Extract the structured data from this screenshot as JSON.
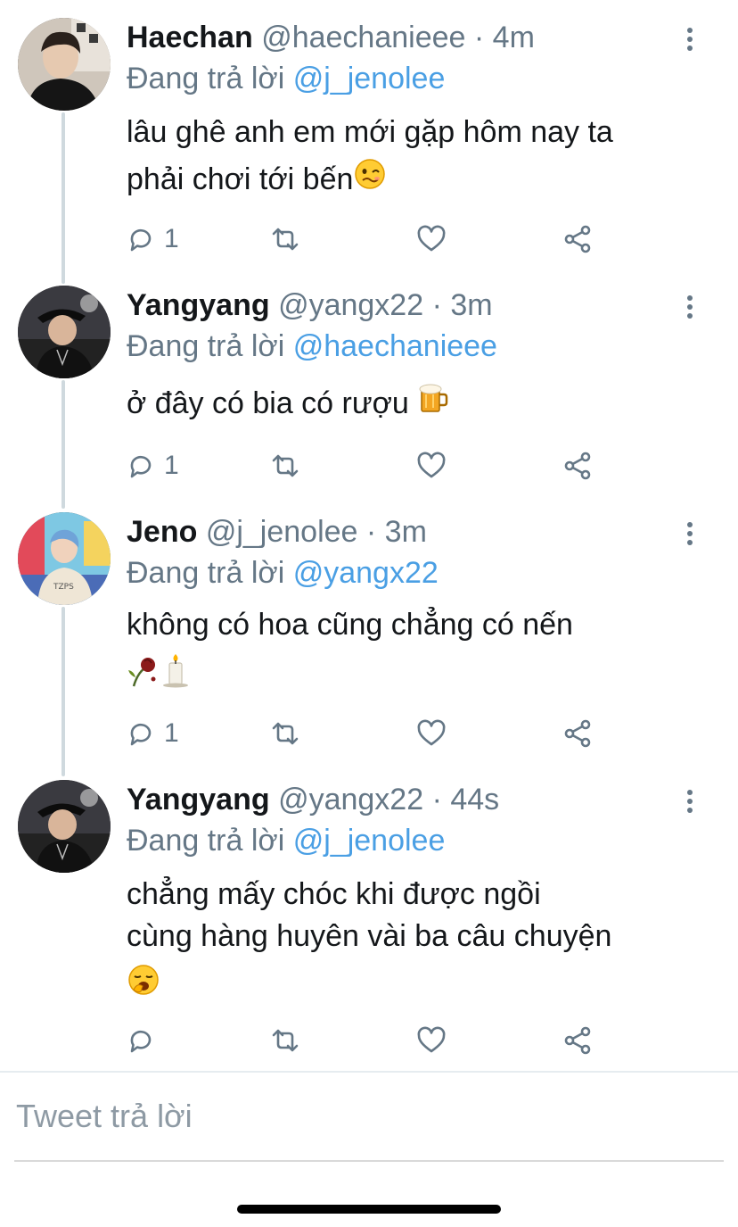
{
  "reply_prefix": "Đang trả lời",
  "tweets": [
    {
      "name": "Haechan",
      "handle": "@haechanieee",
      "time": "4m",
      "reply_to": "@j_jenolee",
      "lines": [
        "lâu ghê anh em mới gặp hôm nay ta",
        "phải chơi tới bến"
      ],
      "emoji": "woozy-face",
      "reply_count": "1"
    },
    {
      "name": "Yangyang",
      "handle": "@yangx22",
      "time": "3m",
      "reply_to": "@haechanieee",
      "lines": [
        "ở đây có bia có rượu"
      ],
      "emoji": "beer-mug",
      "reply_count": "1"
    },
    {
      "name": "Jeno",
      "handle": "@j_jenolee",
      "time": "3m",
      "reply_to": "@yangx22",
      "lines": [
        "không có hoa cũng chẳng có nến"
      ],
      "emoji": "wilted-rose-and-candle",
      "reply_count": "1"
    },
    {
      "name": "Yangyang",
      "handle": "@yangx22",
      "time": "44s",
      "reply_to": "@j_jenolee",
      "lines": [
        "chẳng mấy chóc khi được ngồi",
        "cùng hàng huyên vài ba câu chuyện"
      ],
      "emoji": "yawning-face",
      "reply_count": ""
    }
  ],
  "compose": {
    "placeholder": "Tweet trả lời"
  },
  "colors": {
    "link": "#4a9fe4",
    "muted": "#657786",
    "text": "#14171a",
    "thread_line": "#cfd9de"
  }
}
